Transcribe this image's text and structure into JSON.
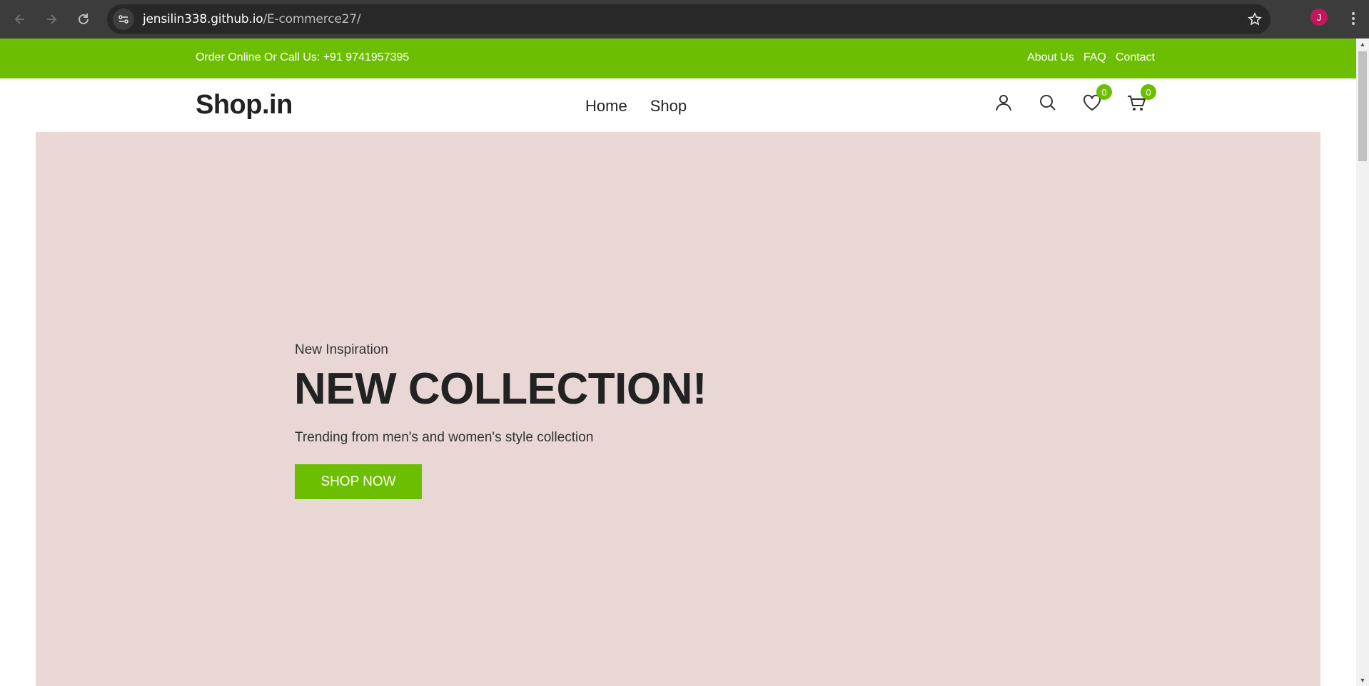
{
  "browser": {
    "url_host": "jensilin338.github.io",
    "url_path": "/E-commerce27/",
    "profile_initial": "J"
  },
  "topbar": {
    "phone_text": "Order Online Or Call Us: +91 9741957395",
    "links": [
      "About Us",
      "FAQ",
      "Contact"
    ]
  },
  "header": {
    "logo": "Shop.in",
    "nav": [
      "Home",
      "Shop"
    ],
    "wishlist_count": "0",
    "cart_count": "0"
  },
  "hero": {
    "eyebrow": "New Inspiration",
    "headline": "NEW COLLECTION!",
    "subtitle": "Trending from men's and women's style collection",
    "cta_label": "SHOP NOW"
  },
  "colors": {
    "accent": "#6cbf00",
    "hero_bg": "#e8d7d5",
    "text": "#222222"
  },
  "icons": [
    "back-icon",
    "forward-icon",
    "reload-icon",
    "site-info-icon",
    "bookmark-star-icon",
    "user-icon",
    "search-icon",
    "heart-icon",
    "cart-icon"
  ]
}
